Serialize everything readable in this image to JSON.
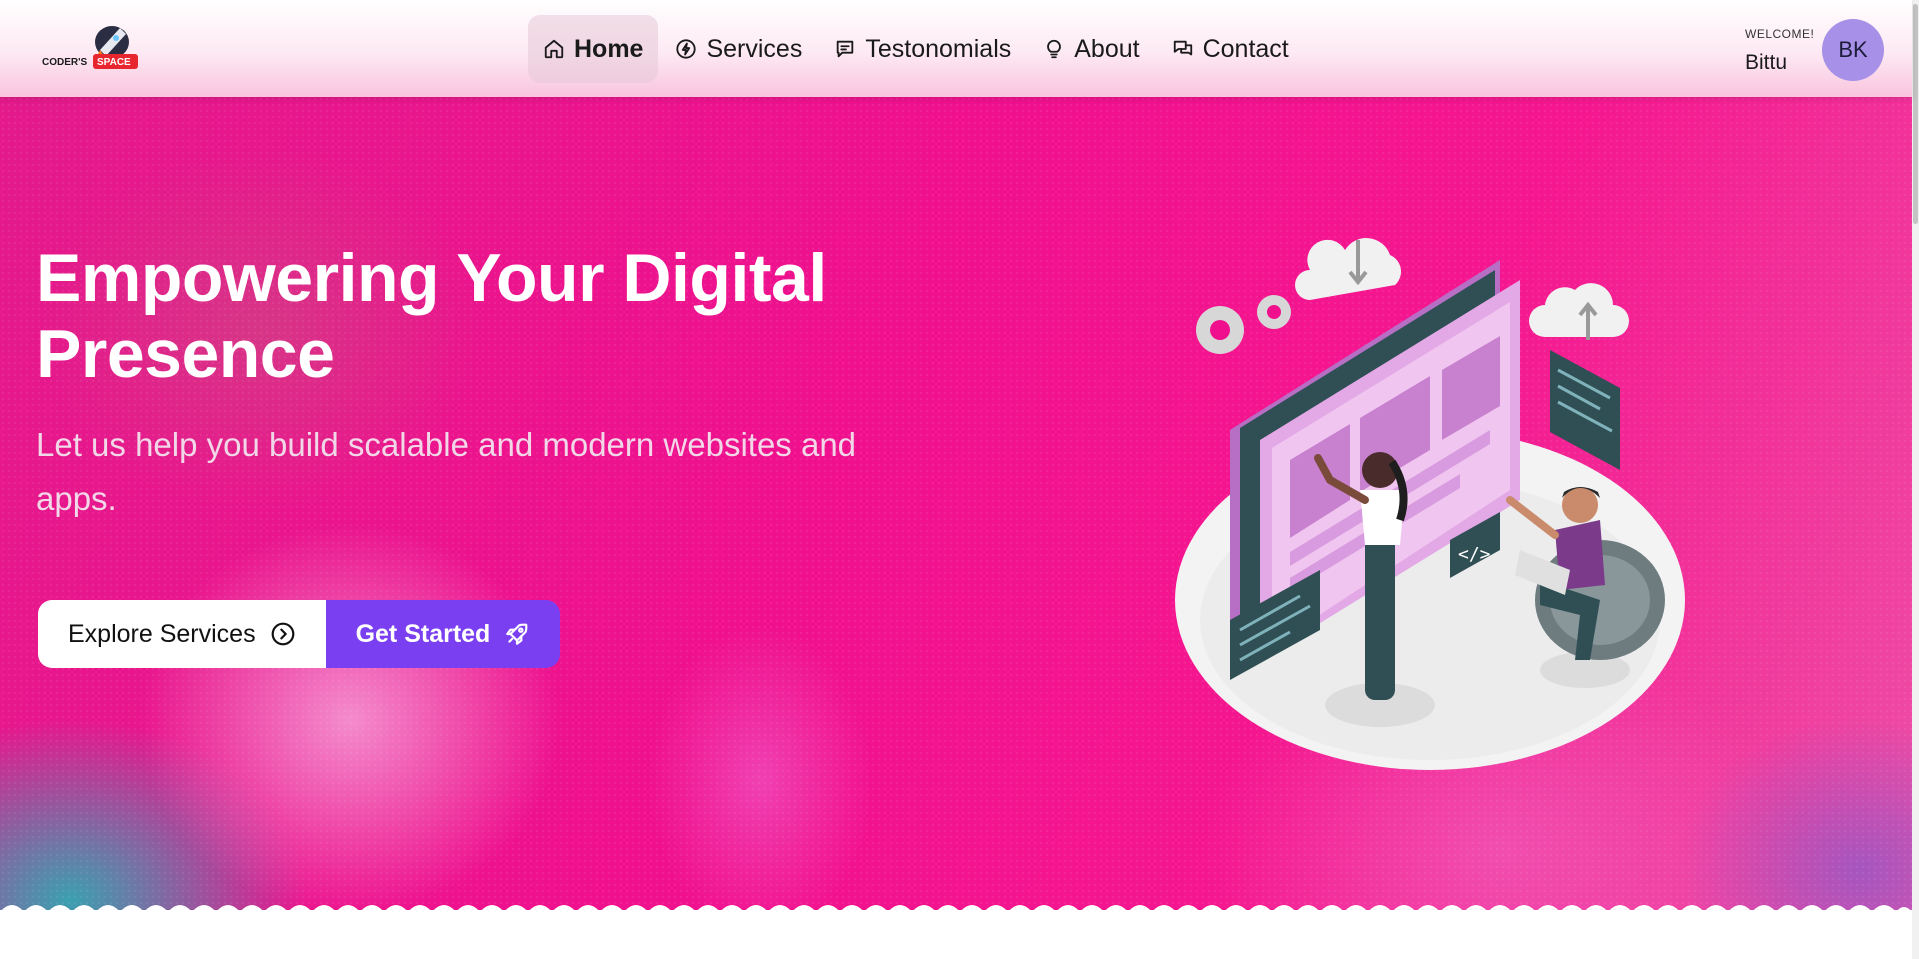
{
  "brand": {
    "logo_text_left": "CODER'S",
    "logo_text_right": "SPACE"
  },
  "nav": {
    "items": [
      {
        "label": "Home",
        "icon": "home-icon",
        "active": true
      },
      {
        "label": "Services",
        "icon": "bolt-icon",
        "active": false
      },
      {
        "label": "Testonomials",
        "icon": "message-square-icon",
        "active": false
      },
      {
        "label": "About",
        "icon": "lightbulb-icon",
        "active": false
      },
      {
        "label": "Contact",
        "icon": "chat-bubbles-icon",
        "active": false
      }
    ]
  },
  "user": {
    "welcome": "WELCOME!",
    "name": "Bittu",
    "initials": "BK"
  },
  "hero": {
    "title": "Empowering Your Digital Presence",
    "subtitle": "Let us help you build scalable and modern websites and apps.",
    "primary_button": {
      "label": "Explore Services",
      "icon": "chevron-right-circle-icon"
    },
    "secondary_button": {
      "label": "Get Started",
      "icon": "rocket-icon"
    },
    "illustration": "web-developers-illustration"
  },
  "colors": {
    "hero_pink": "#f0108e",
    "accent_purple": "#7b3ff2",
    "avatar_bg": "#a690e8",
    "nav_tint": "#f9c4de"
  }
}
